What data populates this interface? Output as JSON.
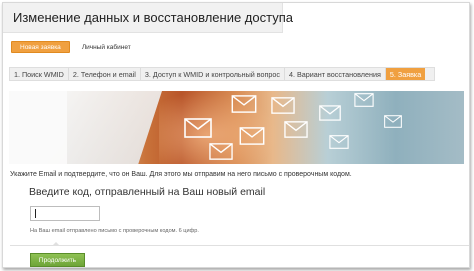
{
  "header": {
    "title": "Изменение данных и восстановление доступа",
    "icon": "key-icon",
    "accent_color": "#f0a040"
  },
  "nav": {
    "new_request": "Новая заявка",
    "personal_account": "Личный кабинет"
  },
  "steps": [
    {
      "label": "1. Поиск WMID",
      "active": false
    },
    {
      "label": "2. Телефон и email",
      "active": false
    },
    {
      "label": "3. Доступ к WMID и контрольный вопрос",
      "active": false
    },
    {
      "label": "4. Вариант восстановления",
      "active": false
    },
    {
      "label": "5. Заявка",
      "active": true
    }
  ],
  "main": {
    "instruction": "Укажите Email и подтвердите, что он Ваш. Для этого мы отправим на него письмо с проверочным кодом.",
    "code_label": "Введите код, отправленный на Ваш новый email",
    "code_value": "",
    "hint": "На Ваш email отправлено письмо с проверочным кодом. 6 цифр.",
    "continue_label": "Продолжить",
    "continue_color": "#7ab342"
  }
}
